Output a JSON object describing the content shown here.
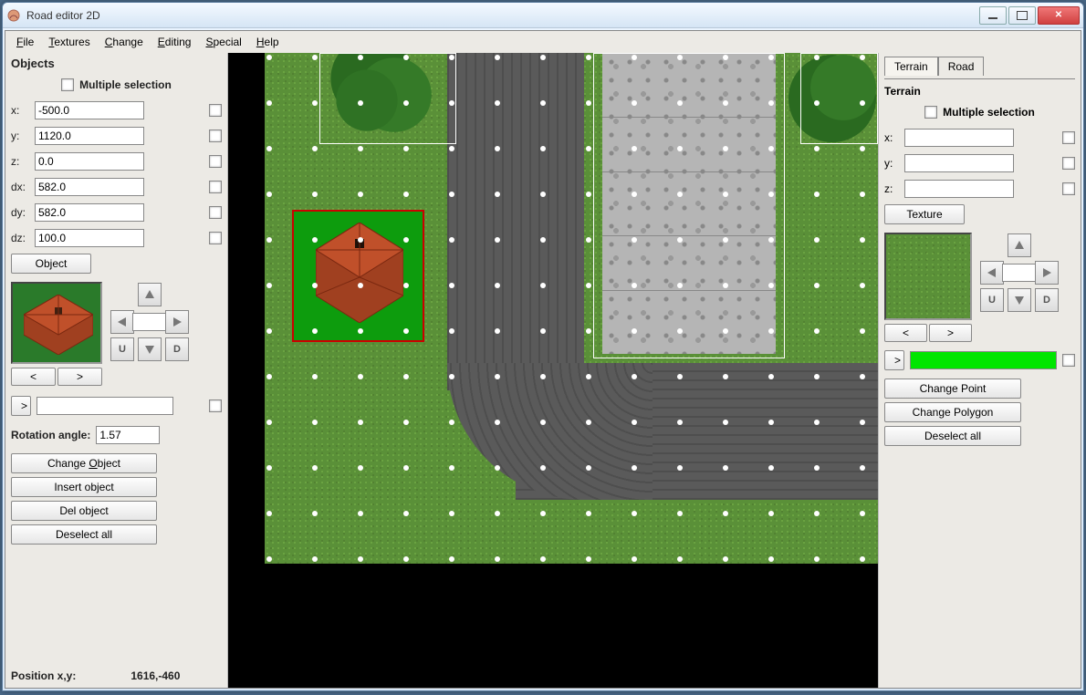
{
  "window": {
    "title": "Road editor 2D"
  },
  "menu": {
    "file": "File",
    "textures": "Textures",
    "change": "Change",
    "editing": "Editing",
    "special": "Special",
    "help": "Help"
  },
  "leftpanel": {
    "heading": "Objects",
    "multisel": "Multiple selection",
    "labels": {
      "x": "x:",
      "y": "y:",
      "z": "z:",
      "dx": "dx:",
      "dy": "dy:",
      "dz": "dz:"
    },
    "vals": {
      "x": "-500.0",
      "y": "1120.0",
      "z": "0.0",
      "dx": "582.0",
      "dy": "582.0",
      "dz": "100.0"
    },
    "object_btn": "Object",
    "nav": {
      "U": "U",
      "D": "D",
      "prev": "<",
      "next": ">",
      "gt": ">"
    },
    "rotation_label": "Rotation angle:",
    "rotation_val": "1.57",
    "btns": {
      "change": "Change Object",
      "insert": "Insert object",
      "del": "Del object",
      "deselect": "Deselect all"
    },
    "status": {
      "label": "Position x,y:",
      "value": "1616,-460"
    }
  },
  "rightpanel": {
    "tabs": {
      "terrain": "Terrain",
      "road": "Road"
    },
    "heading": "Terrain",
    "multisel": "Multiple selection",
    "labels": {
      "x": "x:",
      "y": "y:",
      "z": "z:"
    },
    "texture_btn": "Texture",
    "nav": {
      "U": "U",
      "D": "D",
      "prev": "<",
      "next": ">",
      "gt": ">"
    },
    "btns": {
      "changepoint": "Change Point",
      "changepoly": "Change Polygon",
      "deselect": "Deselect all"
    }
  }
}
